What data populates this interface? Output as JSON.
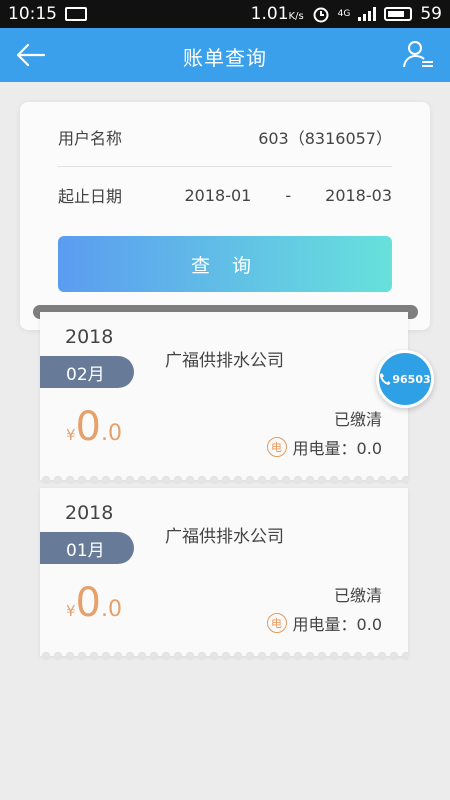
{
  "status_bar": {
    "time": "10:15",
    "speed": "1.01",
    "speed_unit": "K/s",
    "network": "4G",
    "battery": "59"
  },
  "header": {
    "title": "账单查询",
    "back_icon": "arrow-left-icon",
    "user_icon": "user-list-icon"
  },
  "query": {
    "user_label": "用户名称",
    "user_value": "603（8316057）",
    "date_label": "起止日期",
    "start_date": "2018-01",
    "date_separator": "-",
    "end_date": "2018-03",
    "button_label": "查  询"
  },
  "bills": [
    {
      "year": "2018",
      "month": "02月",
      "company": "广福供排水公司",
      "status": "已缴清",
      "currency": "¥",
      "amount_int": "0",
      "amount_dec": ".0",
      "usage_icon": "电",
      "usage_text": "用电量：0.0"
    },
    {
      "year": "2018",
      "month": "01月",
      "company": "广福供排水公司",
      "status": "已缴清",
      "currency": "¥",
      "amount_int": "0",
      "amount_dec": ".0",
      "usage_icon": "电",
      "usage_text": "用电量：0.0"
    }
  ],
  "hotline": {
    "number": "96503",
    "icon": "phone-icon"
  },
  "colors": {
    "header": "#3aa0ec",
    "button_start": "#5b9cf0",
    "button_end": "#67e1dc",
    "month_tag": "#677b98",
    "amount": "#e6a06a",
    "hotline": "#2da0e6"
  }
}
